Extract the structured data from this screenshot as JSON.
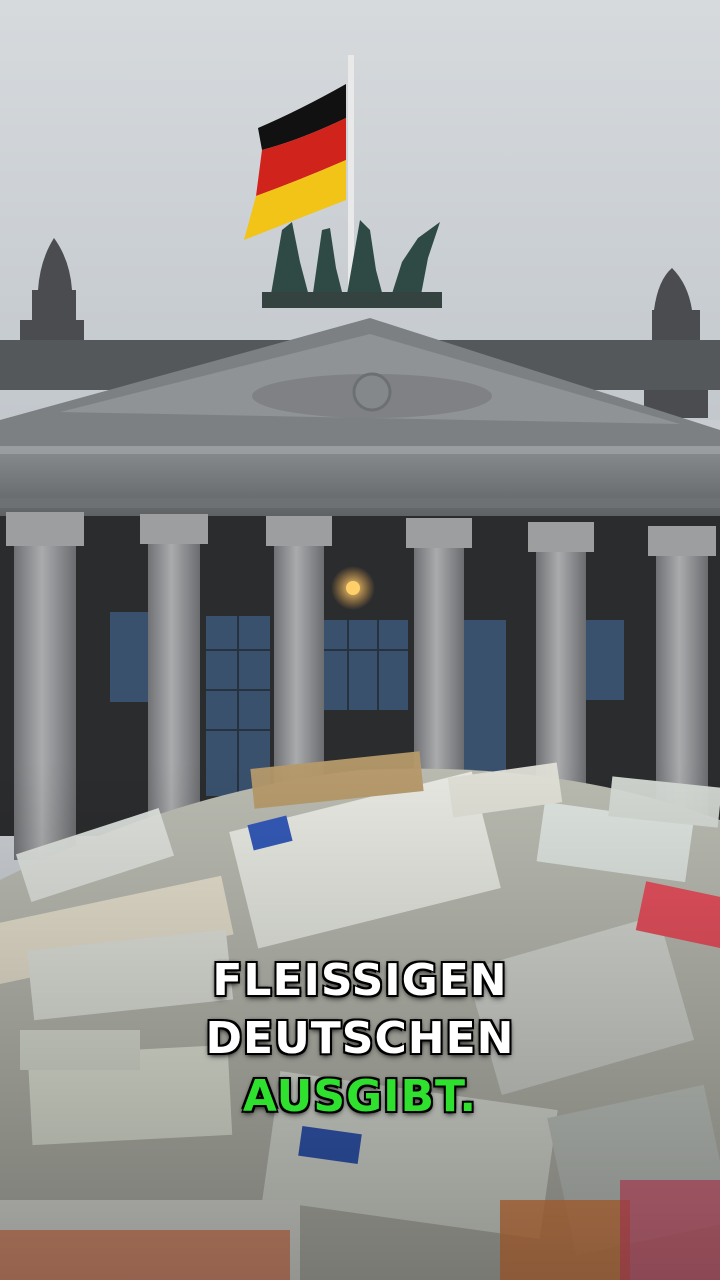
{
  "caption": {
    "lines": [
      "FLEISSIGEN",
      "DEUTSCHEN",
      "AUSGIBT."
    ],
    "highlight_line_color": "#2fe02f",
    "text_color": "#ffffff"
  },
  "scene": {
    "subject": "government building with columns, flag and quadriga, pile of euro banknotes in foreground",
    "flag_colors": [
      "#111111",
      "#d0231c",
      "#f2c417"
    ]
  }
}
